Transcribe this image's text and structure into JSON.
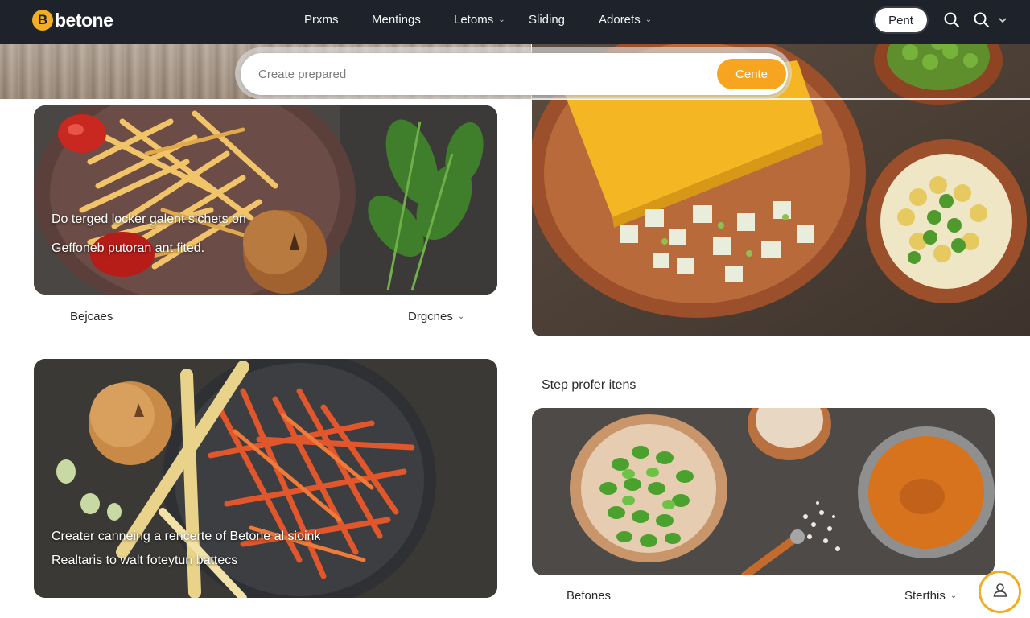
{
  "brand": {
    "logo_letter": "B",
    "name": "betone",
    "accent": "#f2ad22"
  },
  "nav": {
    "items": [
      {
        "label": "Prxms",
        "has_dropdown": false
      },
      {
        "label": "Mentings",
        "has_dropdown": false
      },
      {
        "label": "Letoms",
        "has_dropdown": true
      },
      {
        "label": "Sliding",
        "has_dropdown": false
      },
      {
        "label": "Adorets",
        "has_dropdown": true
      }
    ],
    "post_button": "Pent",
    "icons": [
      "search-icon",
      "search-icon",
      "chevron-down-icon"
    ],
    "chevron_glyph": "⌄"
  },
  "search": {
    "placeholder": "Create prepared",
    "button_label": "Cente",
    "button_color": "#f7a51e"
  },
  "cards": {
    "fries": {
      "line1": "Do terged locker galent sichets on",
      "line2": "Geffoneb putoran ant fited.",
      "meta_left": "Bejcaes",
      "meta_right": "Drgcnes"
    },
    "carrots": {
      "line1": "Creater canneing a rencerte of Betone al sioink",
      "line2": "Realtaris to walt foteytun battecs"
    },
    "bowls_side": {
      "section_title": "Step profer itens"
    },
    "peas": {
      "meta_left": "Befones",
      "meta_right": "Sterthis"
    }
  },
  "fab": {
    "icon": "user-icon",
    "border_color": "#f2ad22"
  }
}
